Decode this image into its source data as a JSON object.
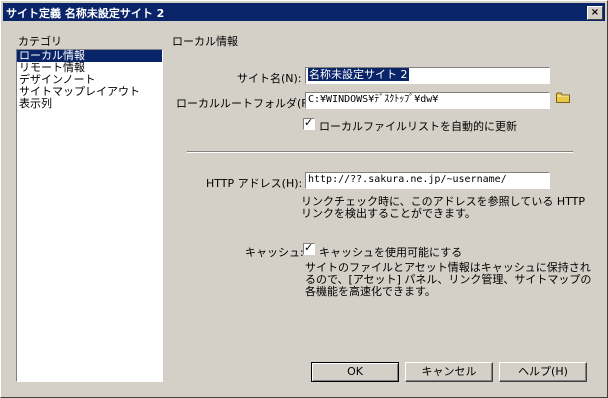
{
  "window": {
    "title": "サイト定義 名称未設定サイト 2",
    "close_label": "×"
  },
  "category": {
    "header": "カテゴリ",
    "items": [
      "ローカル情報",
      "リモート情報",
      "デザインノート",
      "サイトマップレイアウト",
      "表示列"
    ],
    "selected_index": 0
  },
  "section_title": "ローカル情報",
  "site_name": {
    "label": "サイト名(N):",
    "value": "名称未設定サイト 2"
  },
  "local_root": {
    "label": "ローカルルートフォルダ(F):",
    "value": "C:¥WINDOWS¥ﾃﾞｽｸﾄｯﾌﾟ¥dw¥"
  },
  "auto_refresh": {
    "label": "ローカルファイルリストを自動的に更新",
    "checked": true
  },
  "http": {
    "label": "HTTP アドレス(H):",
    "value": "http://??.sakura.ne.jp/~username/",
    "desc_line1": "リンクチェック時に、このアドレスを参照している HTTP",
    "desc_line2": "リンクを検出することができます。"
  },
  "cache": {
    "label": "キャッシュ:",
    "check_label": "キャッシュを使用可能にする",
    "checked": true,
    "desc_line1": "サイトのファイルとアセット情報はキャッシュに保持され",
    "desc_line2": "るので、[アセット] パネル、リンク管理、サイトマップの",
    "desc_line3": "各機能を高速化できます。"
  },
  "buttons": {
    "ok": "OK",
    "cancel": "キャンセル",
    "help": "ヘルプ(H)"
  },
  "check_mark": "✓",
  "icons": {
    "folder": "folder-icon",
    "close": "close-icon"
  },
  "colors": {
    "selection": "#0a246a",
    "face": "#d4d0c8",
    "folder": "#e8c848"
  }
}
